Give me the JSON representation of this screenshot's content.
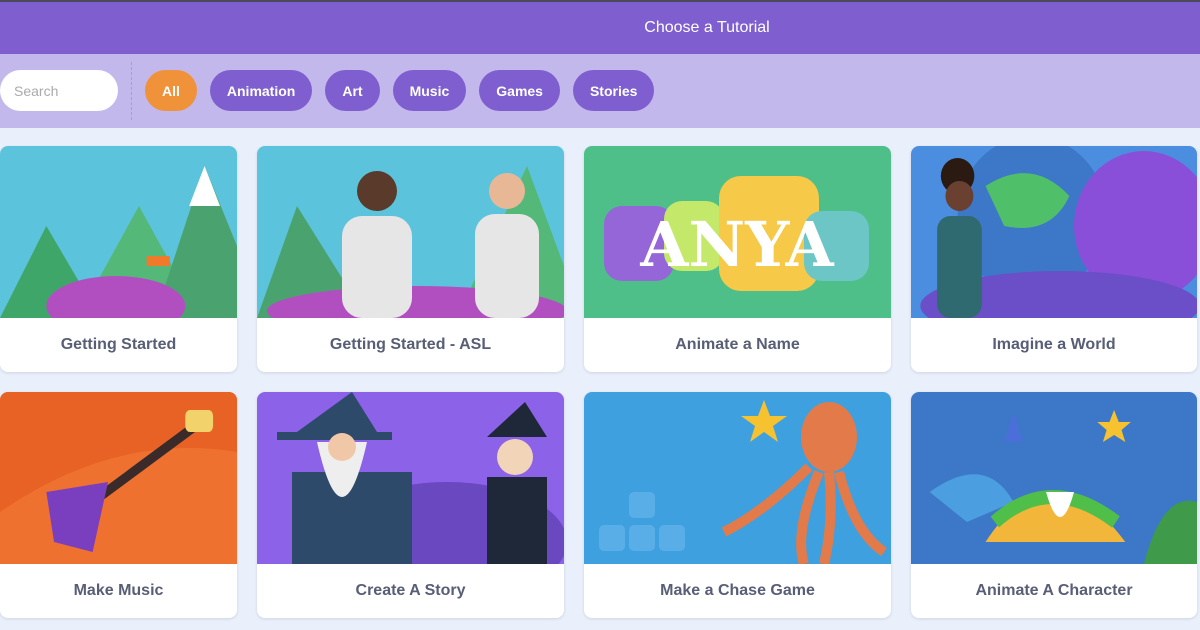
{
  "header": {
    "title": "Choose a Tutorial"
  },
  "search": {
    "placeholder": "Search"
  },
  "filters": [
    {
      "label": "All",
      "active": true
    },
    {
      "label": "Animation",
      "active": false
    },
    {
      "label": "Art",
      "active": false
    },
    {
      "label": "Music",
      "active": false
    },
    {
      "label": "Games",
      "active": false
    },
    {
      "label": "Stories",
      "active": false
    }
  ],
  "colors": {
    "header": "#7f5fcf",
    "filter_bar": "#c3b8ec",
    "active_chip": "#f0923a",
    "chip": "#7f5fcf",
    "background": "#e9f0fc",
    "card_text": "#575e75"
  },
  "tutorials": [
    {
      "title": "Getting Started"
    },
    {
      "title": "Getting Started - ASL"
    },
    {
      "title": "Animate a Name",
      "thumb_text": "ANYA"
    },
    {
      "title": "Imagine a World"
    },
    {
      "title": "Make Music"
    },
    {
      "title": "Create A Story"
    },
    {
      "title": "Make a Chase Game"
    },
    {
      "title": "Animate A Character"
    }
  ]
}
